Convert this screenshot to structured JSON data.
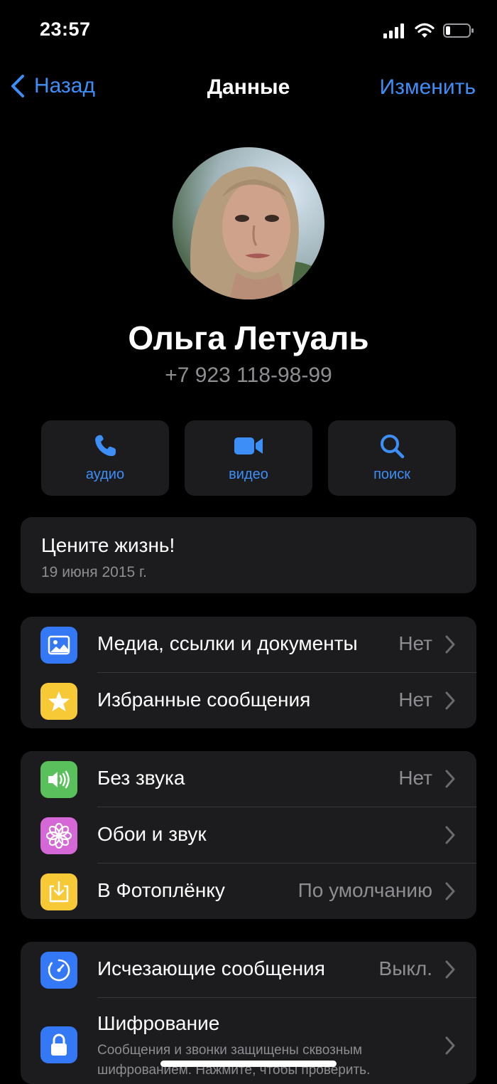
{
  "status_bar": {
    "time": "23:57"
  },
  "nav": {
    "back_label": "Назад",
    "title": "Данные",
    "edit_label": "Изменить"
  },
  "contact": {
    "name": "Ольга Летуаль",
    "phone": "+7 923 118-98-99"
  },
  "actions": {
    "audio": "аудио",
    "video": "видео",
    "search": "поиск"
  },
  "about": {
    "text": "Цените жизнь!",
    "date": "19 июня 2015 г."
  },
  "group1": [
    {
      "label": "Медиа, ссылки и документы",
      "value": "Нет",
      "icon": "image-icon",
      "color": "#3478f6"
    },
    {
      "label": "Избранные сообщения",
      "value": "Нет",
      "icon": "star-icon",
      "color": "#f7c937"
    }
  ],
  "group2": [
    {
      "label": "Без звука",
      "value": "Нет",
      "icon": "speaker-icon",
      "color": "#5ac05c"
    },
    {
      "label": "Обои и звук",
      "value": "",
      "icon": "flower-icon",
      "color": "#d567d7"
    },
    {
      "label": "В Фотоплёнку",
      "value": "По умолчанию",
      "icon": "save-download-icon",
      "color": "#f7c937"
    }
  ],
  "group3": {
    "disappearing": {
      "label": "Исчезающие сообщения",
      "value": "Выкл.",
      "icon": "timer-icon",
      "color": "#3478f6"
    },
    "encryption": {
      "label": "Шифрование",
      "sub": "Сообщения и звонки защищены сквозным шифрованием. Нажмите, чтобы проверить.",
      "icon": "lock-icon",
      "color": "#3478f6"
    }
  },
  "colors": {
    "accent": "#3e8ef7",
    "card_bg": "#1c1c1e",
    "secondary_text": "#8d8d92"
  }
}
